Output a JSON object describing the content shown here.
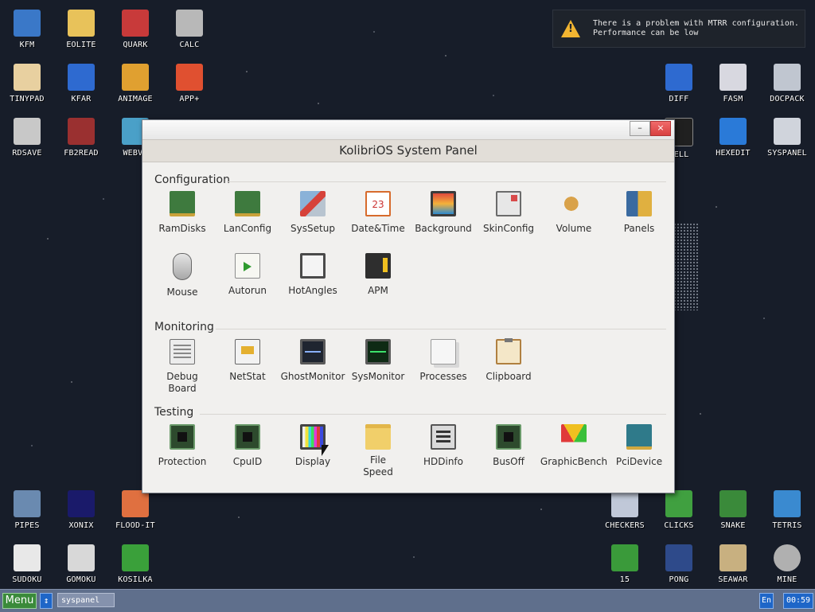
{
  "desktop": {
    "icons": [
      {
        "label": "KFM",
        "icon": "floppy-icon",
        "color": "#3a78c8"
      },
      {
        "label": "EOLITE",
        "icon": "folder-icon",
        "color": "#e8c25a"
      },
      {
        "label": "QUARK",
        "icon": "book-icon",
        "color": "#c83a3a"
      },
      {
        "label": "CALC",
        "icon": "calculator-icon",
        "color": "#b8b8b8"
      },
      {
        "label": "TINYPAD",
        "icon": "notepad-icon",
        "color": "#e8d0a0"
      },
      {
        "label": "KFAR",
        "icon": "kfar-icon",
        "color": "#2e6ad0"
      },
      {
        "label": "ANIMAGE",
        "icon": "brush-icon",
        "color": "#e0a030"
      },
      {
        "label": "APP+",
        "icon": "cube-icon",
        "color": "#e05030"
      },
      {
        "label": "RDSAVE",
        "icon": "ramdisk-save-icon",
        "color": "#c8c8c8"
      },
      {
        "label": "FB2READ",
        "icon": "fb2-book-icon",
        "color": "#9a3030"
      },
      {
        "label": "WEBVI",
        "icon": "web-icon",
        "color": "#4aa0c8"
      },
      {
        "label": "DIFF",
        "icon": "diff-icon",
        "color": "#2e6ad0"
      },
      {
        "label": "FASM",
        "icon": "fasm-icon",
        "color": "#d8d8e0"
      },
      {
        "label": "DOCPACK",
        "icon": "docpack-icon",
        "color": "#c0c6d0"
      },
      {
        "label": "HELL",
        "icon": "terminal-icon",
        "color": "#202020"
      },
      {
        "label": "HEXEDIT",
        "icon": "hexedit-icon",
        "color": "#2a7ad8"
      },
      {
        "label": "SYSPANEL",
        "icon": "syspanel-icon",
        "color": "#d0d4dc"
      },
      {
        "label": "PIPES",
        "icon": "pipes-icon",
        "color": "#6a8ab0"
      },
      {
        "label": "XONIX",
        "icon": "xonix-icon",
        "color": "#1a1a6a"
      },
      {
        "label": "FLOOD-IT",
        "icon": "flood-it-icon",
        "color": "#e07040"
      },
      {
        "label": "CHECKERS",
        "icon": "checkers-icon",
        "color": "#c0c8d8"
      },
      {
        "label": "CLICKS",
        "icon": "clicks-icon",
        "color": "#40a040"
      },
      {
        "label": "SNAKE",
        "icon": "snake-icon",
        "color": "#3a8a3a"
      },
      {
        "label": "TETRIS",
        "icon": "tetris-icon",
        "color": "#3a8ad0"
      },
      {
        "label": "SUDOKU",
        "icon": "sudoku-icon",
        "color": "#e8e8e8"
      },
      {
        "label": "GOMOKU",
        "icon": "gomoku-icon",
        "color": "#d8d8d8"
      },
      {
        "label": "KOSILKA",
        "icon": "lawnmower-icon",
        "color": "#3aa03a"
      },
      {
        "label": "15",
        "icon": "fifteen-icon",
        "color": "#3a9a3a"
      },
      {
        "label": "PONG",
        "icon": "pong-icon",
        "color": "#2e4a8a"
      },
      {
        "label": "SEAWAR",
        "icon": "ship-icon",
        "color": "#c8b080"
      },
      {
        "label": "MINE",
        "icon": "mine-icon",
        "color": "#b0b0b0"
      }
    ]
  },
  "notification": {
    "line1": "There is a problem with MTRR configuration.",
    "line2": "Performance can be low",
    "icon": "warning-icon",
    "color": "#f2b531"
  },
  "window": {
    "title": "KolibriOS System Panel",
    "minimize_label": "–",
    "close_label": "×",
    "sections": [
      {
        "title": "Configuration",
        "items": [
          {
            "label": "RamDisks",
            "icon": "ramdisk-icon"
          },
          {
            "label": "LanConfig",
            "icon": "network-card-icon"
          },
          {
            "label": "SysSetup",
            "icon": "tools-icon"
          },
          {
            "label": "Date&Time",
            "icon": "calendar-icon"
          },
          {
            "label": "Background",
            "icon": "monitor-icon"
          },
          {
            "label": "SkinConfig",
            "icon": "skin-icon"
          },
          {
            "label": "Volume",
            "icon": "speaker-icon"
          },
          {
            "label": "Panels",
            "icon": "panels-icon"
          },
          {
            "label": "Mouse",
            "icon": "mouse-icon"
          },
          {
            "label": "Autorun",
            "icon": "autorun-icon"
          },
          {
            "label": "HotAngles",
            "icon": "hotangles-icon"
          },
          {
            "label": "APM",
            "icon": "battery-icon"
          }
        ]
      },
      {
        "title": "Monitoring",
        "items": [
          {
            "label": "Debug Board",
            "icon": "debug-board-icon"
          },
          {
            "label": "NetStat",
            "icon": "netstat-icon"
          },
          {
            "label": "GhostMonitor",
            "icon": "ghostmonitor-icon"
          },
          {
            "label": "SysMonitor",
            "icon": "sysmonitor-icon"
          },
          {
            "label": "Processes",
            "icon": "processes-icon"
          },
          {
            "label": "Clipboard",
            "icon": "clipboard-icon"
          }
        ]
      },
      {
        "title": "Testing",
        "items": [
          {
            "label": "Protection",
            "icon": "chip-icon"
          },
          {
            "label": "CpuID",
            "icon": "cpu-icon"
          },
          {
            "label": "Display",
            "icon": "color-bars-icon"
          },
          {
            "label": "File Speed",
            "icon": "folder-icon"
          },
          {
            "label": "HDDinfo",
            "icon": "hdd-icon"
          },
          {
            "label": "BusOff",
            "icon": "bus-chip-icon"
          },
          {
            "label": "GraphicBench",
            "icon": "gauge-icon"
          },
          {
            "label": "PciDevice",
            "icon": "pci-card-icon"
          }
        ]
      }
    ]
  },
  "taskbar": {
    "menu_label": "Menu",
    "switch_label": "↕",
    "task_label": "syspanel",
    "lang_label": "En",
    "time": "00:59"
  }
}
